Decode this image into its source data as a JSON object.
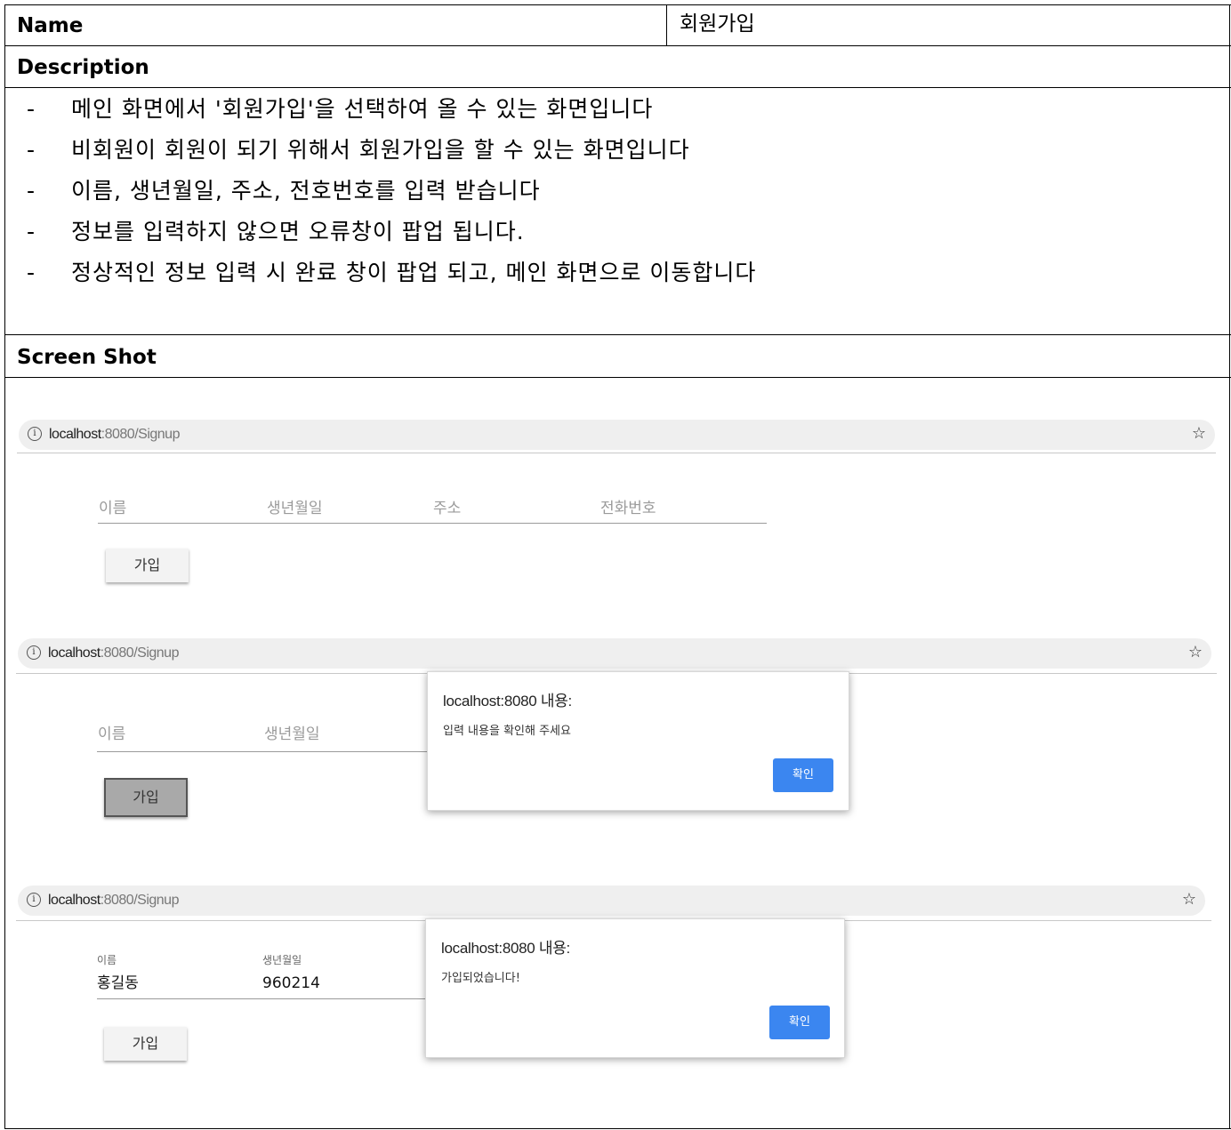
{
  "table": {
    "name_label": "Name",
    "name_value": "회원가입",
    "description_label": "Description",
    "description_items": [
      "메인 화면에서 '회원가입'을 선택하여 올 수 있는 화면입니다",
      "비회원이 회원이 되기 위해서 회원가입을 할 수 있는 화면입니다",
      "이름, 생년월일, 주소, 전호번호를 입력 받습니다",
      "정보를 입력하지 않으면 오류창이 팝업 됩니다.",
      "정상적인 정보 입력 시 완료 창이 팝업 되고, 메인 화면으로 이동합니다"
    ],
    "bullet": "-",
    "screenshot_label": "Screen Shot"
  },
  "browser": {
    "url_host": "localhost",
    "url_rest": ":8080/Signup",
    "info_glyph": "i",
    "star_glyph": "☆"
  },
  "form": {
    "fields": [
      "이름",
      "생년월일",
      "주소",
      "전화번호"
    ],
    "submit_label": "가입"
  },
  "dialog_error": {
    "title": "localhost:8080 내용:",
    "message": "입력 내용을 확인해 주세요",
    "ok_label": "확인"
  },
  "dialog_success": {
    "title": "localhost:8080 내용:",
    "message": "가입되었습니다!",
    "ok_label": "확인"
  },
  "filled_values": {
    "name": "홍길동",
    "birth": "960214"
  }
}
